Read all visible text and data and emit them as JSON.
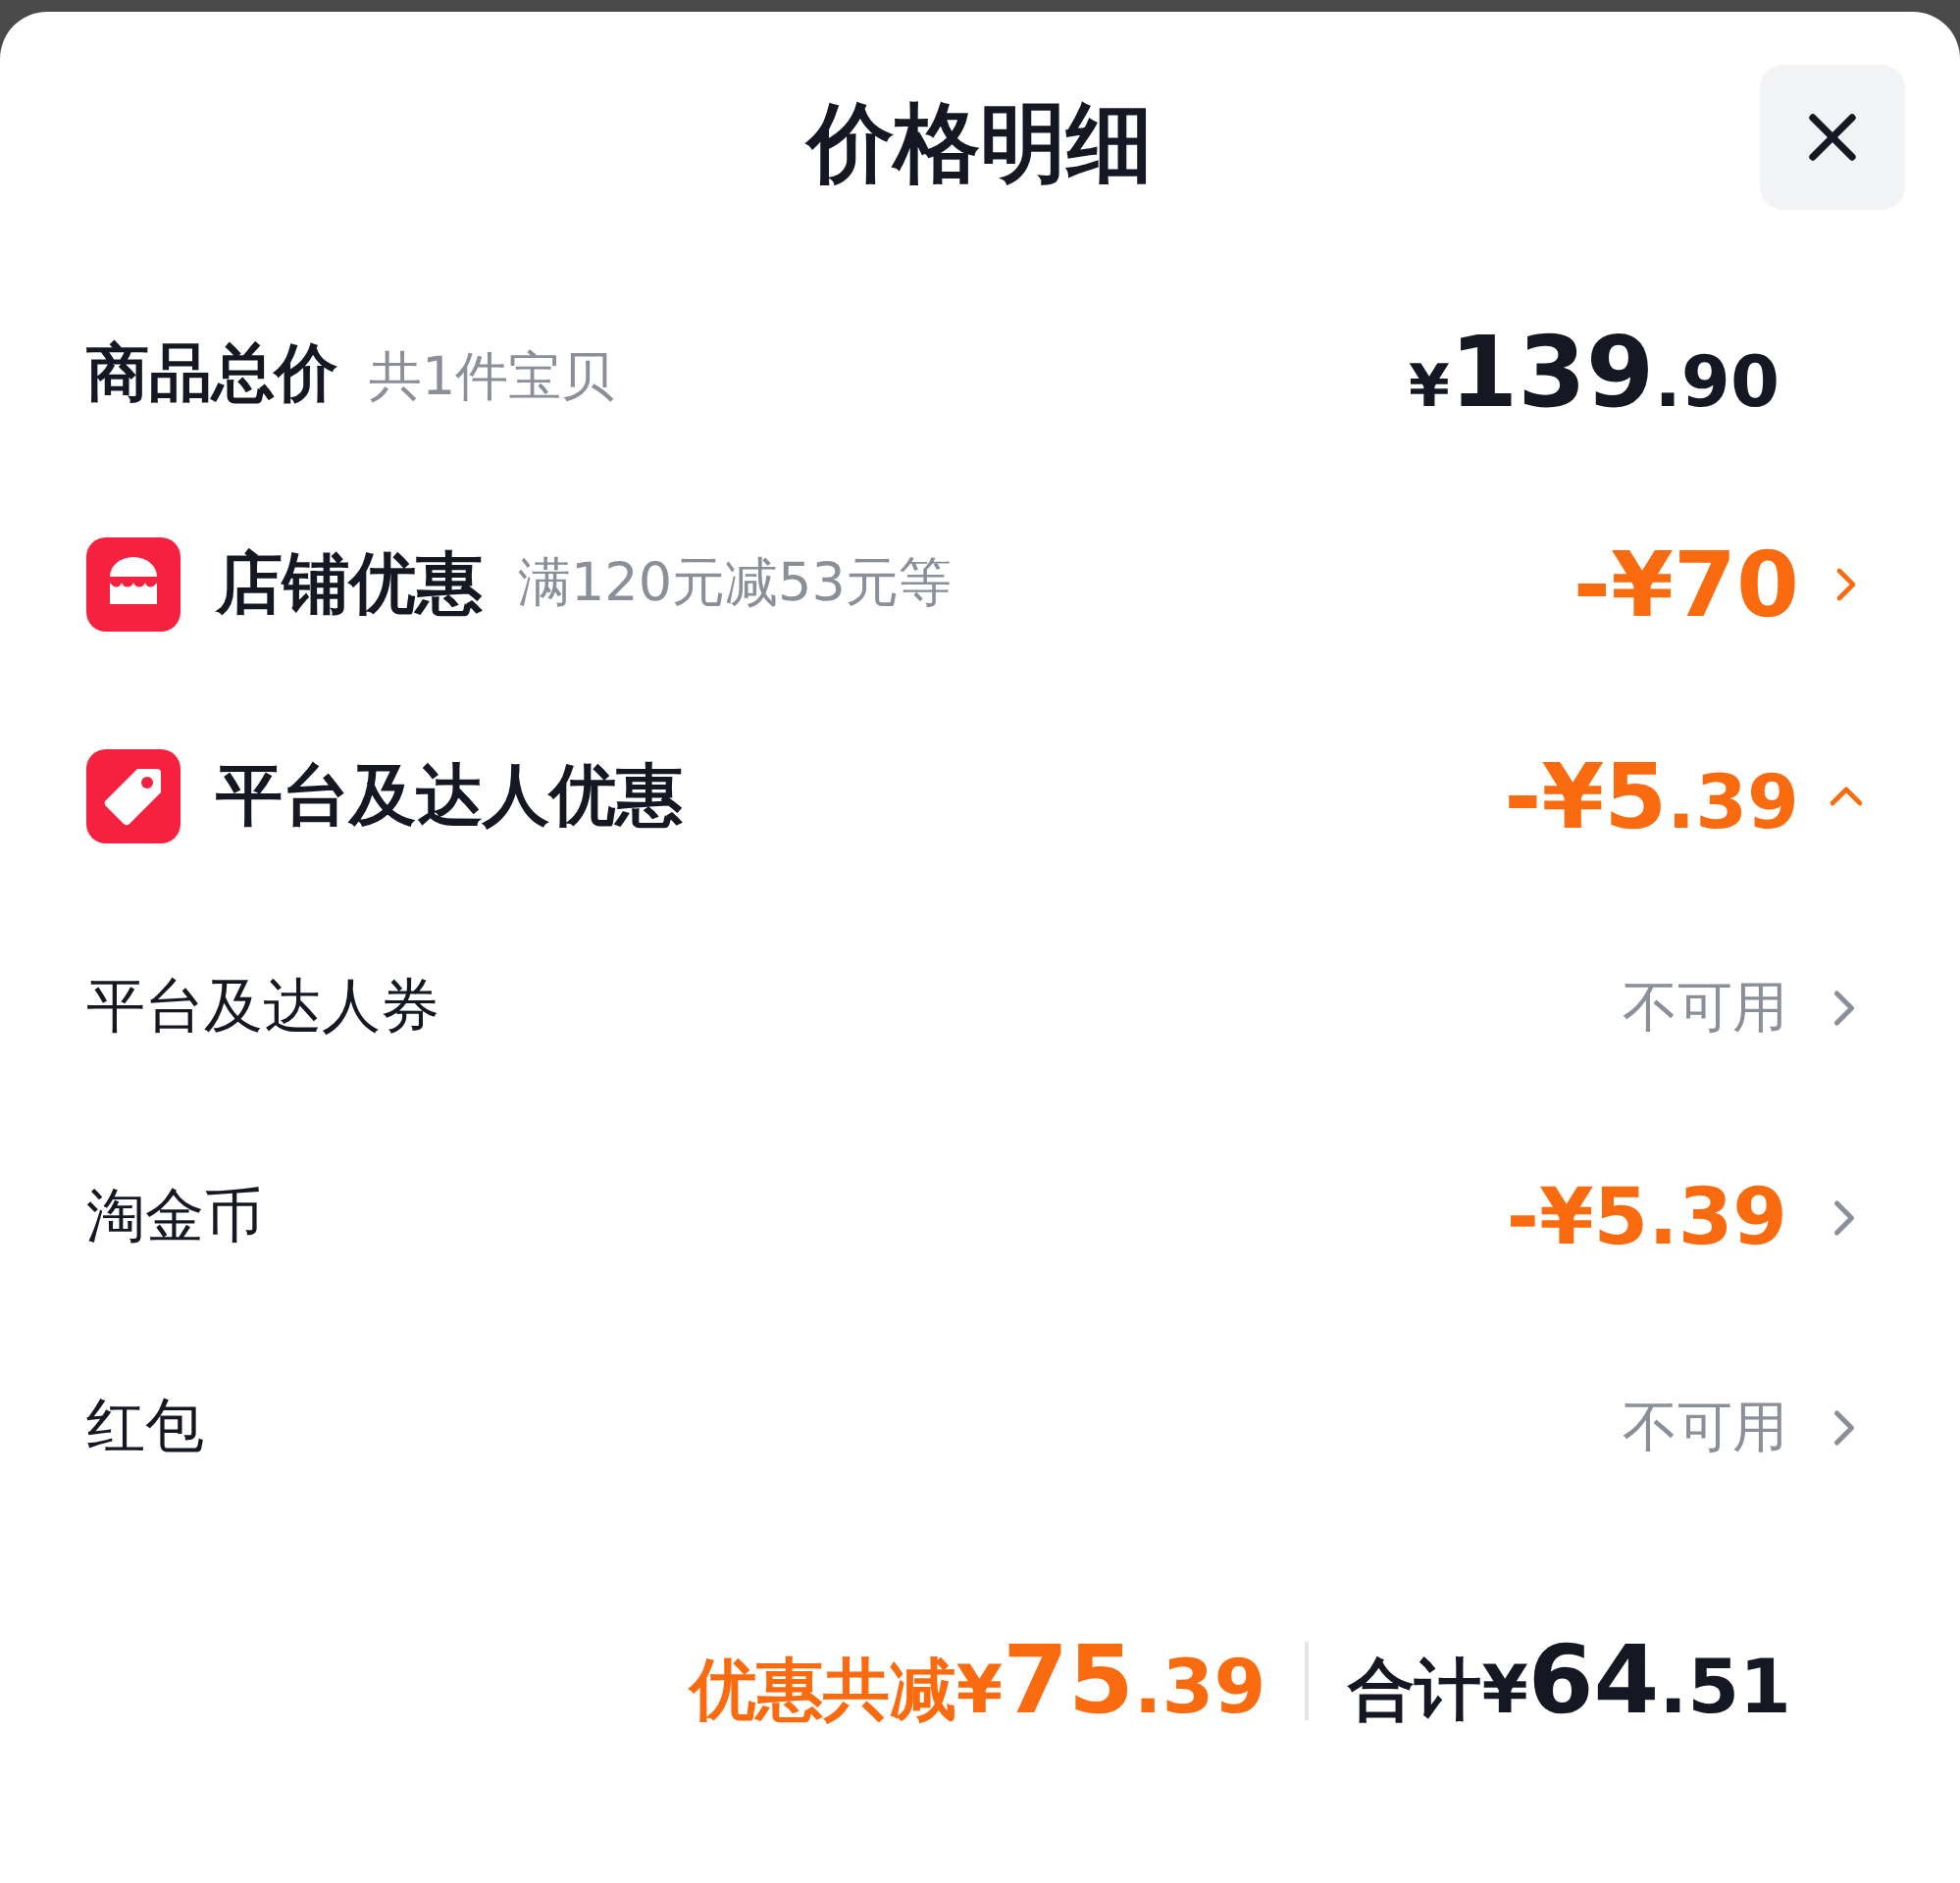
{
  "title": "价格明细",
  "total": {
    "label": "商品总价",
    "note": "共1件宝贝",
    "currency": "¥",
    "main": "139",
    "fraction": ".90"
  },
  "sections": [
    {
      "kind": "shop",
      "label": "店铺优惠",
      "note": "满120元减53元等",
      "main": "-¥70",
      "expanded": false
    },
    {
      "kind": "tag",
      "label": "平台及达人优惠",
      "main": "-¥5",
      "fraction": ".39",
      "expanded": true,
      "children": [
        {
          "label": "平台及达人券",
          "kind": "unavailable",
          "value": "不可用"
        },
        {
          "label": "淘金币",
          "kind": "discount",
          "value": "-¥5.39"
        },
        {
          "label": "红包",
          "kind": "unavailable",
          "value": "不可用"
        }
      ]
    }
  ],
  "footer": {
    "saved_label": "优惠共减¥",
    "saved_main": "75",
    "saved_fraction": ".39",
    "total_label": "合计¥",
    "total_main": "64",
    "total_fraction": ".51"
  }
}
